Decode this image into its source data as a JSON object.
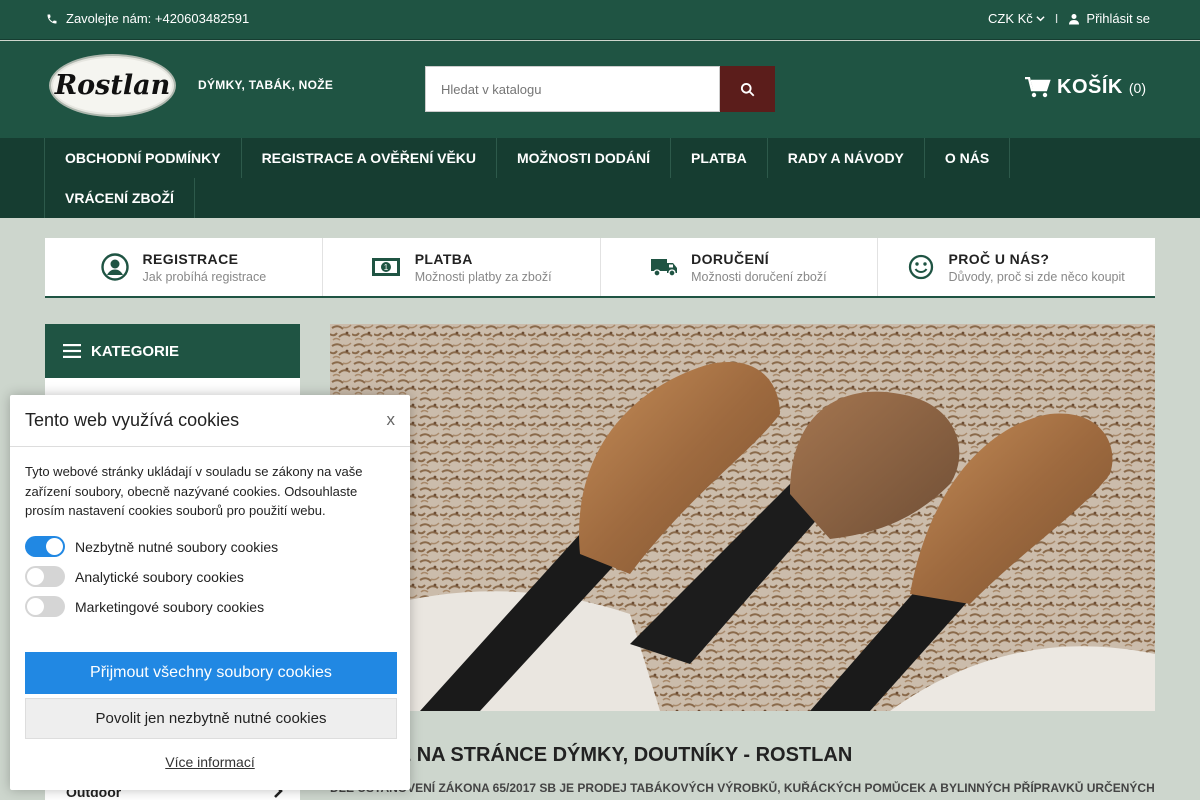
{
  "topbar": {
    "phone": "Zavolejte nám: +420603482591",
    "currency": "CZK Kč",
    "separator": "I",
    "login": "Přihlásit se"
  },
  "header": {
    "logo_text": "Rostlan",
    "tagline": "DÝMKY, TABÁK, NOŽE",
    "search_placeholder": "Hledat v katalogu",
    "cart_label": "KOŠÍK",
    "cart_count": "(0)"
  },
  "nav": {
    "row1": [
      "OBCHODNÍ PODMÍNKY",
      "REGISTRACE A OVĚŘENÍ VĚKU",
      "MOŽNOSTI DODÁNÍ",
      "PLATBA",
      "RADY A NÁVODY",
      "O NÁS"
    ],
    "row2": [
      "VRÁCENÍ ZBOŽÍ"
    ]
  },
  "features": [
    {
      "icon": "user-circle-icon",
      "title": "REGISTRACE",
      "subtitle": "Jak probíhá registrace"
    },
    {
      "icon": "money-icon",
      "title": "PLATBA",
      "subtitle": "Možnosti platby za zboží"
    },
    {
      "icon": "truck-icon",
      "title": "DORUČENÍ",
      "subtitle": "Možnosti doručení zboží"
    },
    {
      "icon": "smile-icon",
      "title": "PROČ U NÁS?",
      "subtitle": "Důvody, proč si zde něco koupit"
    }
  ],
  "sidebar": {
    "title": "KATEGORIE",
    "visible_item": "Outdoor"
  },
  "main": {
    "welcome": "VÍTEJTE NA STRÁNCE DÝMKY, DOUTNÍKY - ROSTLAN",
    "law_text": "DLE USTANOVENÍ ZÁKONA 65/2017 SB JE PRODEJ TABÁKOVÝCH VÝROBKŮ, KUŘÁCKÝCH POMŮCEK A BYLINNÝCH PŘÍPRAVKŮ URČENÝCH"
  },
  "cookie": {
    "title": "Tento web využívá cookies",
    "close": "x",
    "text": "Tyto webové stránky ukládají v souladu se zákony na vaše zařízení soubory, obecně nazývané cookies. Odsouhlaste prosím nastavení cookies souborů pro použití webu.",
    "toggles": [
      {
        "label": "Nezbytně nutné soubory cookies",
        "on": true
      },
      {
        "label": "Analytické soubory cookies",
        "on": false
      },
      {
        "label": "Marketingové soubory cookies",
        "on": false
      }
    ],
    "accept_all": "Přijmout všechny soubory cookies",
    "accept_necessary": "Povolit jen nezbytně nutné cookies",
    "more_info": "Více informací"
  },
  "colors": {
    "brand_green": "#1f5443",
    "nav_dark": "#163d31",
    "search_button": "#5b1d1b",
    "cookie_blue": "#2188e3"
  }
}
